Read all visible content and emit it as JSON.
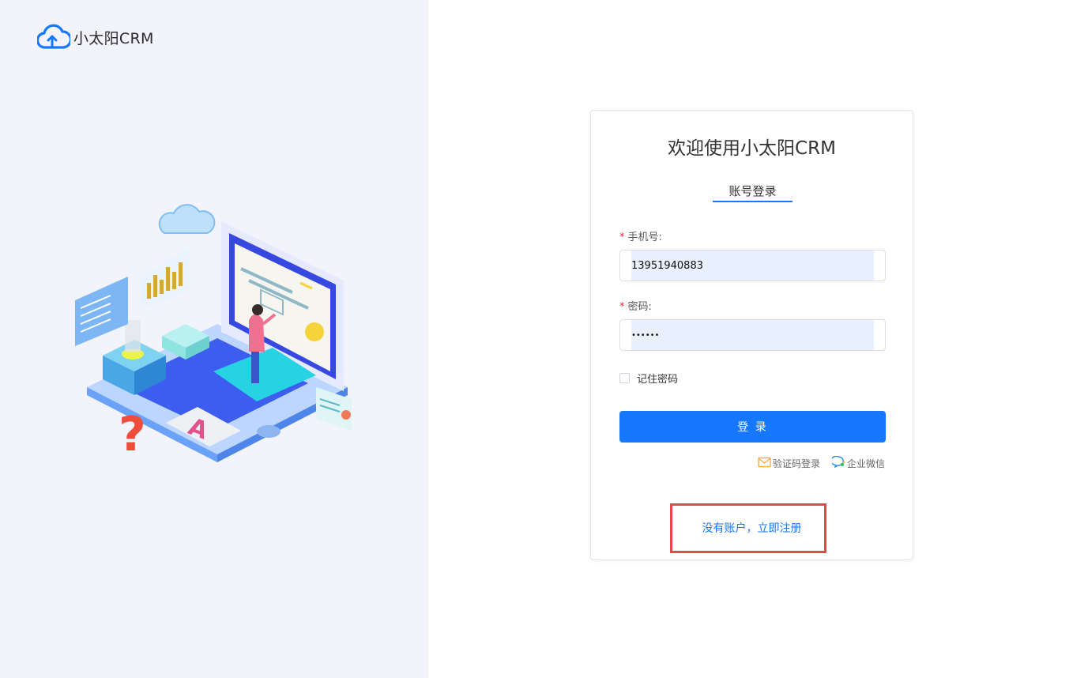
{
  "brand": {
    "name": "小太阳CRM",
    "logo_icon": "cloud-upload-icon",
    "accent_color": "#1677ff"
  },
  "illustration": {
    "icon": "isometric-dashboard-illustration"
  },
  "login": {
    "title": "欢迎使用小太阳CRM",
    "tab_label": "账号登录",
    "phone": {
      "required_mark": "*",
      "label": "手机号:",
      "value": "13951940883"
    },
    "password": {
      "required_mark": "*",
      "label": "密码:",
      "value": "••••••"
    },
    "remember_label": "记住密码",
    "submit_label": "登 录",
    "alt_logins": [
      {
        "label": "验证码登录",
        "icon": "mail-icon"
      },
      {
        "label": "企业微信",
        "icon": "wecom-icon"
      }
    ],
    "register_link": "没有账户，立即注册"
  }
}
